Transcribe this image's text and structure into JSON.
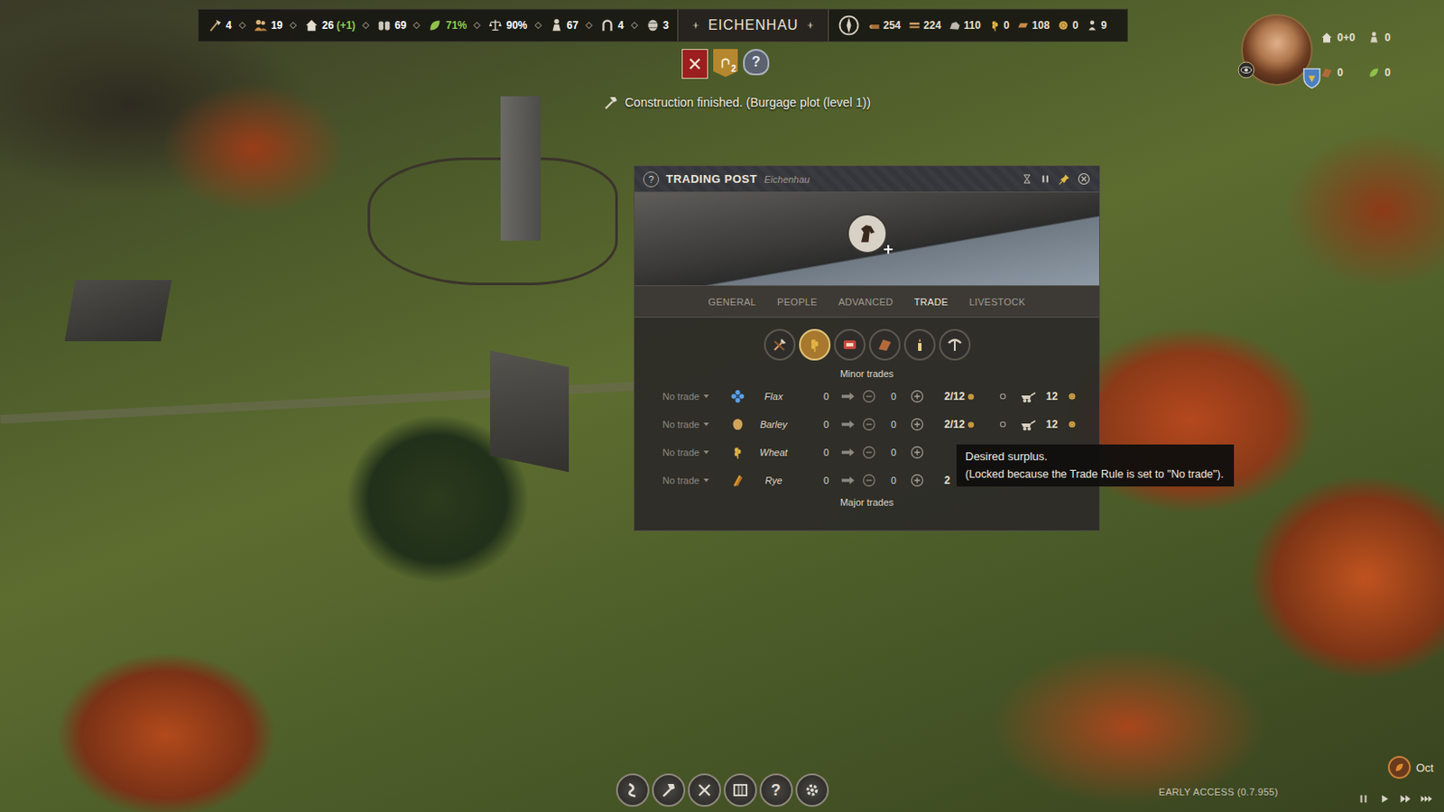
{
  "top_bar": {
    "stats": [
      {
        "value": "4",
        "color": "#ffffff"
      },
      {
        "value": "19",
        "color": "#ffffff"
      },
      {
        "value": "26",
        "delta": "(+1)",
        "color": "#ffffff"
      },
      {
        "value": "69",
        "color": "#ffffff"
      },
      {
        "value": "71%",
        "color": "#8fcf4a"
      },
      {
        "value": "90%",
        "color": "#ffffff"
      },
      {
        "value": "67",
        "color": "#ffffff"
      },
      {
        "value": "4",
        "color": "#ffffff"
      },
      {
        "value": "3",
        "color": "#ffffff"
      }
    ],
    "settlement": "EICHENHAU",
    "resources": [
      {
        "value": "254"
      },
      {
        "value": "224"
      },
      {
        "value": "110"
      },
      {
        "value": "0"
      },
      {
        "value": "108"
      },
      {
        "value": "0"
      },
      {
        "value": "9"
      }
    ]
  },
  "alerts": [
    {
      "kind": "raid"
    },
    {
      "kind": "banner",
      "badge": "2"
    },
    {
      "kind": "help",
      "label": "?"
    }
  ],
  "notification": "Construction finished. (Burgage plot (level 1))",
  "player": {
    "stats": [
      {
        "value": "0+0"
      },
      {
        "value": "0"
      },
      {
        "value": "0"
      },
      {
        "value": "0"
      }
    ]
  },
  "window": {
    "help": "?",
    "title": "TRADING POST",
    "subtitle": "Eichenhau",
    "tabs": [
      {
        "label": "GENERAL",
        "selected": false
      },
      {
        "label": "PEOPLE",
        "selected": false
      },
      {
        "label": "ADVANCED",
        "selected": false
      },
      {
        "label": "TRADE",
        "selected": true
      },
      {
        "label": "LIVESTOCK",
        "selected": false
      }
    ],
    "categories": [
      {
        "selected": false
      },
      {
        "selected": true
      },
      {
        "selected": false
      },
      {
        "selected": false
      },
      {
        "selected": false
      },
      {
        "selected": false
      }
    ],
    "minor_label": "Minor trades",
    "rows": [
      {
        "rule": "No trade",
        "name": "Flax",
        "stock": "0",
        "amount": "0",
        "surplus": "2/12",
        "traders": "12"
      },
      {
        "rule": "No trade",
        "name": "Barley",
        "stock": "0",
        "amount": "0",
        "surplus": "2/12",
        "traders": "12"
      },
      {
        "rule": "No trade",
        "name": "Wheat",
        "stock": "0",
        "amount": "0"
      },
      {
        "rule": "No trade",
        "name": "Rye",
        "stock": "0",
        "amount": "0",
        "surplus": "2"
      }
    ],
    "major_label": "Major trades"
  },
  "tooltip": {
    "title": "Desired surplus.",
    "body": "(Locked because the Trade Rule is set to \"No trade\")."
  },
  "toolbar": {
    "buttons": [
      {
        "kind": "road"
      },
      {
        "kind": "build"
      },
      {
        "kind": "military"
      },
      {
        "kind": "map"
      },
      {
        "kind": "help",
        "label": "?"
      },
      {
        "kind": "settings"
      }
    ]
  },
  "calendar": {
    "month": "Oct"
  },
  "version": "EARLY ACCESS (0.7.955)",
  "speed": [
    {
      "kind": "pause"
    },
    {
      "kind": "play"
    },
    {
      "kind": "fast"
    },
    {
      "kind": "faster"
    }
  ]
}
